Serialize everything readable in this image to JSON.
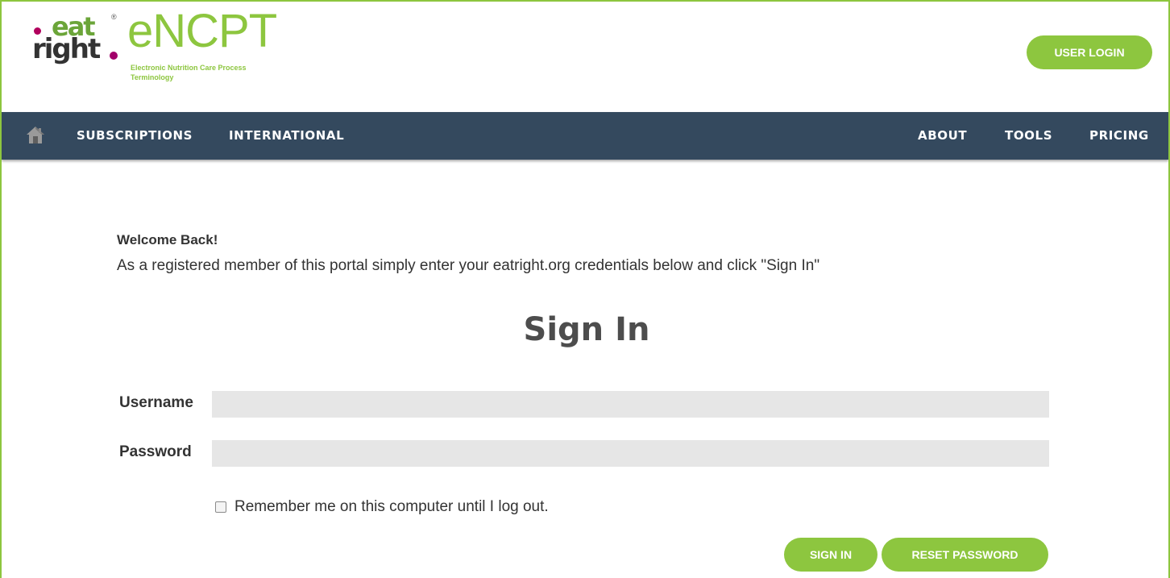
{
  "header": {
    "logo": {
      "eat": "eat",
      "right": "right",
      "registered_mark": "®",
      "product": "eNCPT",
      "tagline_line1": "Electronic Nutrition Care Process",
      "tagline_line2": "Terminology"
    },
    "user_login_label": "USER LOGIN"
  },
  "navbar": {
    "home_icon": "home-icon",
    "left_items": [
      "SUBSCRIPTIONS",
      "INTERNATIONAL"
    ],
    "right_items": [
      "ABOUT",
      "TOOLS",
      "PRICING"
    ]
  },
  "main": {
    "welcome_title": "Welcome Back!",
    "welcome_text": "As a registered member of this portal simply enter your eatright.org credentials below and click \"Sign In\"",
    "heading": "Sign In",
    "username_label": "Username",
    "username_value": "",
    "password_label": "Password",
    "password_value": "",
    "remember_label": "Remember me on this computer until I log out.",
    "sign_in_label": "SIGN IN",
    "reset_password_label": "RESET PASSWORD"
  },
  "colors": {
    "brand_green": "#8dc63f",
    "navbar": "#34495e",
    "input_bg": "#e6e6e6",
    "border": "#8dc63f"
  }
}
